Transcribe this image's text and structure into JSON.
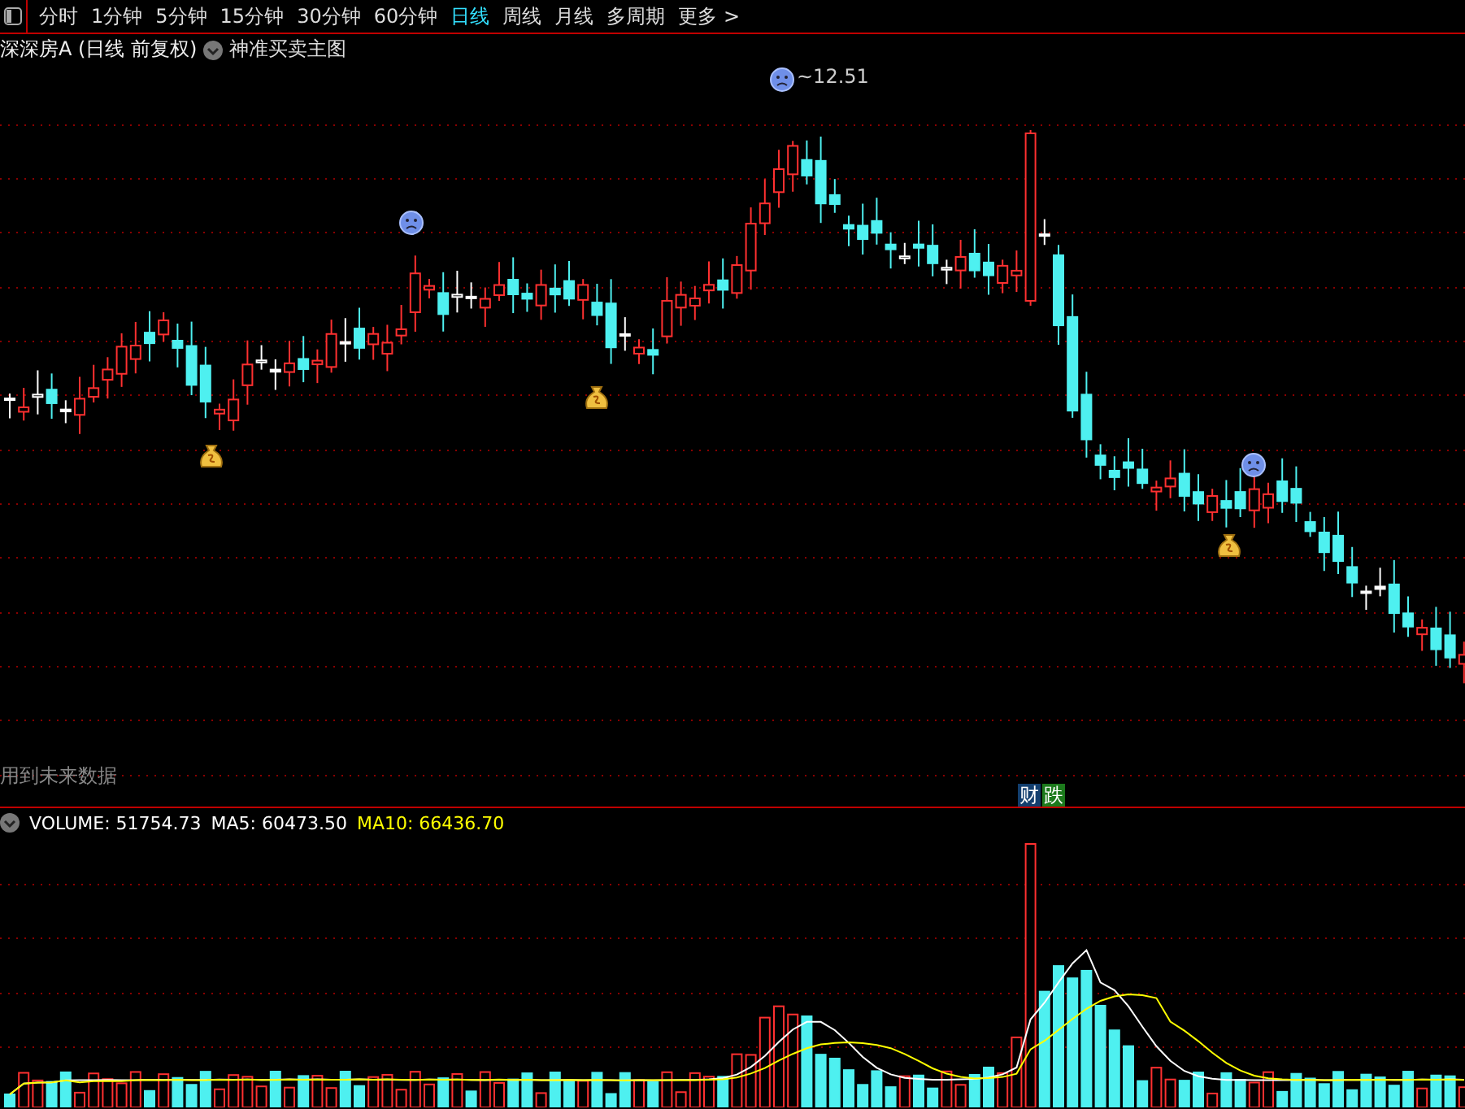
{
  "toolbar": {
    "tabs": [
      {
        "label": "分时",
        "selected": false
      },
      {
        "label": "1分钟",
        "selected": false
      },
      {
        "label": "5分钟",
        "selected": false
      },
      {
        "label": "15分钟",
        "selected": false
      },
      {
        "label": "30分钟",
        "selected": false
      },
      {
        "label": "60分钟",
        "selected": false
      },
      {
        "label": "日线",
        "selected": true
      },
      {
        "label": "周线",
        "selected": false
      },
      {
        "label": "月线",
        "selected": false
      },
      {
        "label": "多周期",
        "selected": false
      },
      {
        "label": "更多 >",
        "selected": false
      }
    ]
  },
  "title": {
    "stock": "深深房A (日线 前复权)",
    "indicator": "神准买卖主图"
  },
  "price_chart": {
    "peak_label": "~12.51",
    "warning": "用到未来数据",
    "badges": [
      {
        "text": "财",
        "color": "#123e6e"
      },
      {
        "text": "跌",
        "color": "#1c7a1c"
      }
    ]
  },
  "volume": {
    "readings": [
      {
        "label": "VOLUME: 51754.73",
        "color": "#ffffff"
      },
      {
        "label": "MA5: 60473.50",
        "color": "#ffffff"
      },
      {
        "label": "MA10: 66436.70",
        "color": "#ffff00"
      }
    ]
  }
}
